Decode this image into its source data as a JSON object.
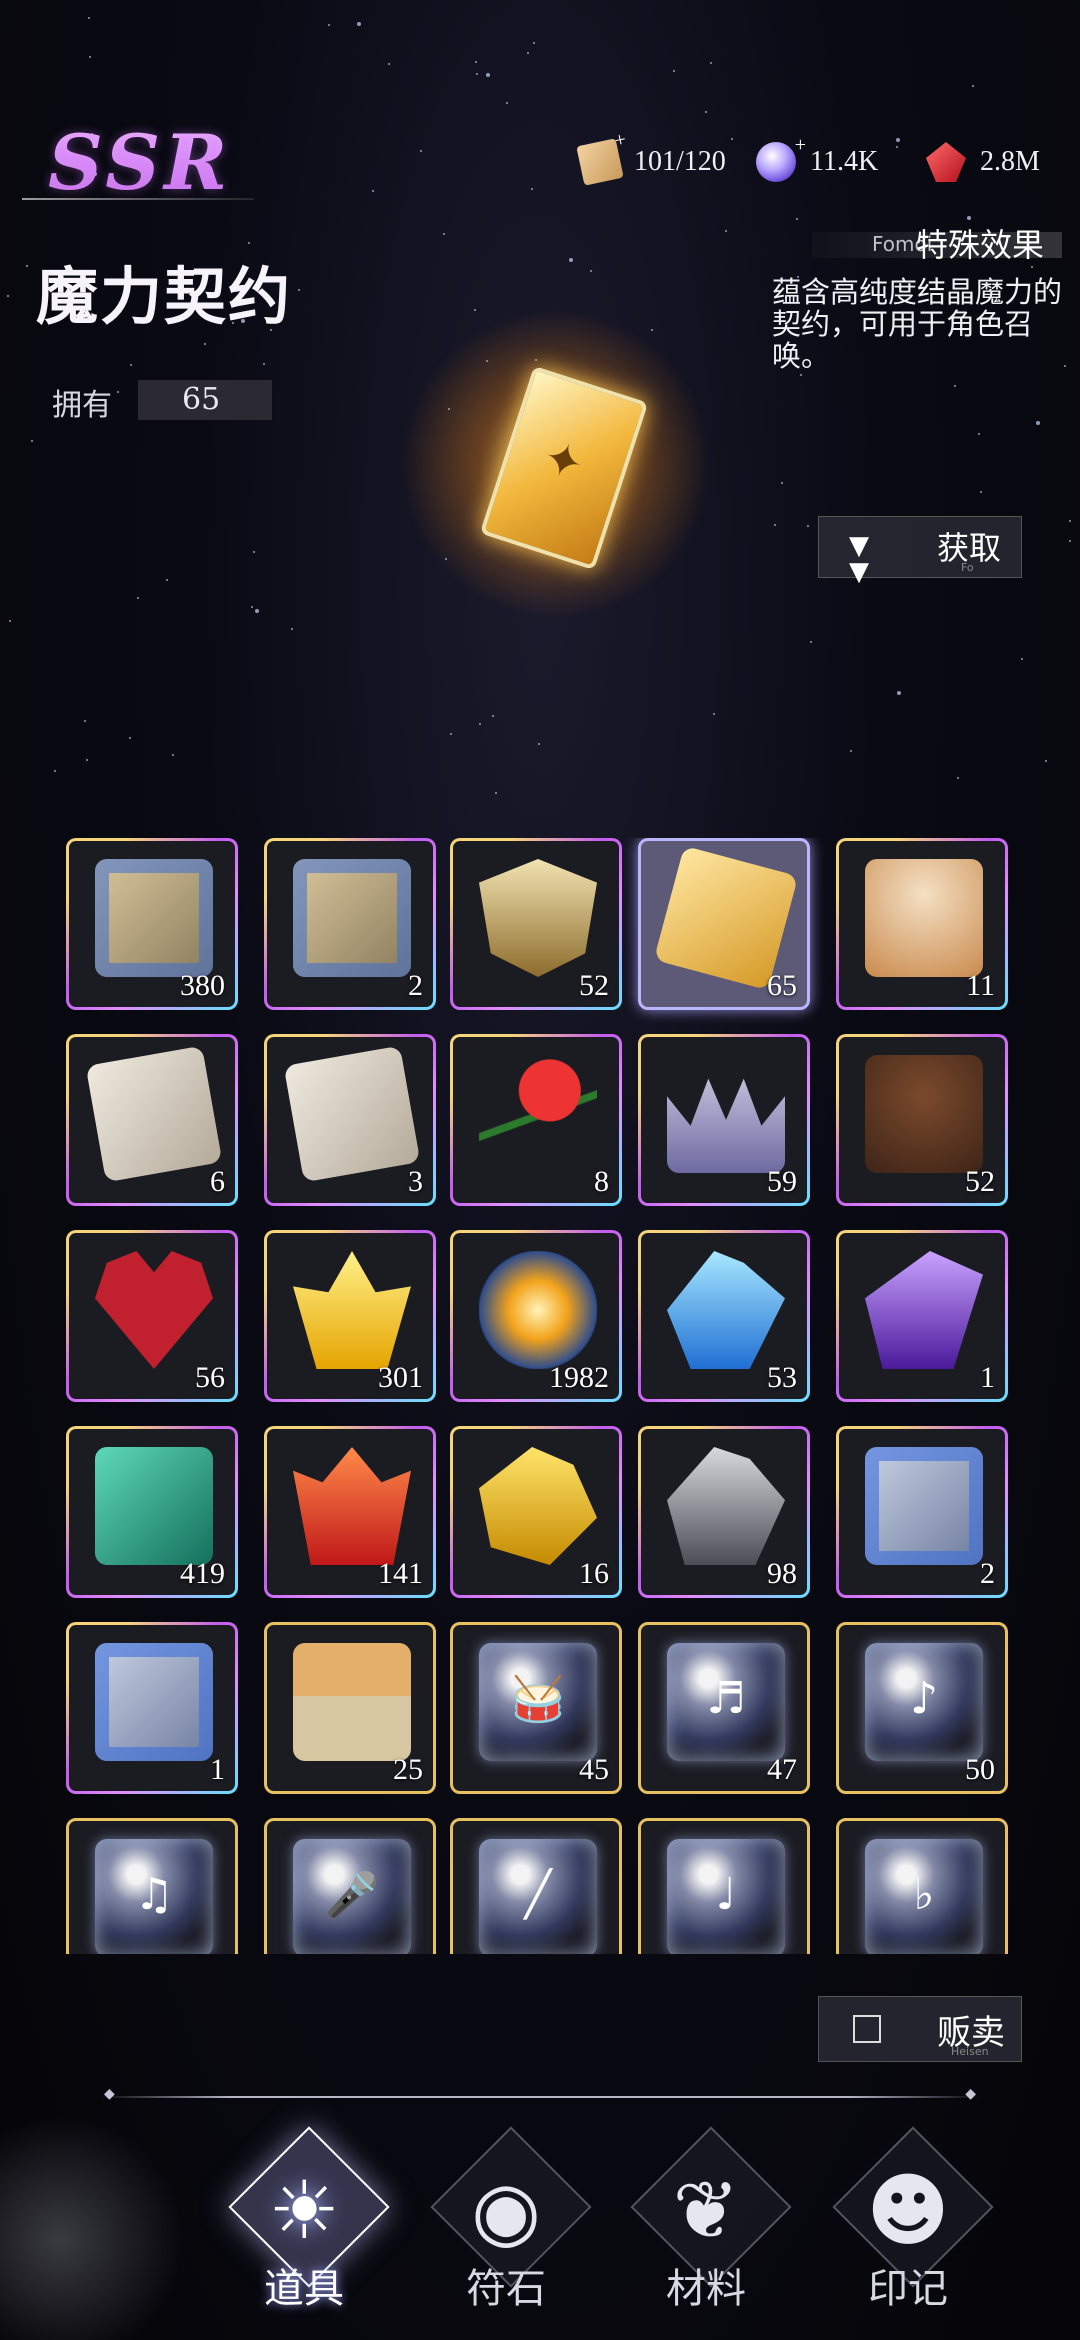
{
  "rarity": "SSR",
  "item": {
    "name": "魔力契约",
    "own_label": "拥有",
    "own_count": "65",
    "effect_en": "Fomoi",
    "effect_label": "特殊效果",
    "description": "蕴含高纯度结晶魔力的契约，可用于角色召唤。",
    "icon": "golden-contract-icon"
  },
  "resources": [
    {
      "icon": "stamina-ticket-icon",
      "value": "101/120"
    },
    {
      "icon": "crystal-orb-icon",
      "value": "11.4K"
    },
    {
      "icon": "red-gem-icon",
      "value": "2.8M"
    }
  ],
  "obtain": {
    "label": "获取",
    "sub": "Fo"
  },
  "sell": {
    "label": "贩卖",
    "sub": "Heisen"
  },
  "grid": [
    {
      "icon": "treasure-chest-icon",
      "count": "380",
      "frame": "purple"
    },
    {
      "icon": "treasure-chest-icon",
      "count": "2",
      "frame": "purple"
    },
    {
      "icon": "gold-shield-icon",
      "count": "52",
      "frame": "purple"
    },
    {
      "icon": "golden-contract-icon",
      "count": "65",
      "frame": "selected"
    },
    {
      "icon": "cake-icon",
      "count": "11",
      "frame": "purple"
    },
    {
      "icon": "sheet-music-icon",
      "count": "6",
      "frame": "purple"
    },
    {
      "icon": "sheet-music-icon",
      "count": "3",
      "frame": "purple"
    },
    {
      "icon": "red-rose-icon",
      "count": "8",
      "frame": "purple"
    },
    {
      "icon": "jewel-crown-icon",
      "count": "59",
      "frame": "purple"
    },
    {
      "icon": "chocolate-cake-icon",
      "count": "52",
      "frame": "purple"
    },
    {
      "icon": "heart-gift-box-icon",
      "count": "56",
      "frame": "purple"
    },
    {
      "icon": "yellow-crystal-icon",
      "count": "301",
      "frame": "purple"
    },
    {
      "icon": "golden-orb-icon",
      "count": "1982",
      "frame": "purple"
    },
    {
      "icon": "blue-crystal-icon",
      "count": "53",
      "frame": "purple"
    },
    {
      "icon": "purple-crystal-icon",
      "count": "1",
      "frame": "purple"
    },
    {
      "icon": "green-ore-icon",
      "count": "419",
      "frame": "purple"
    },
    {
      "icon": "red-crystal-icon",
      "count": "141",
      "frame": "purple"
    },
    {
      "icon": "gold-crystal-icon",
      "count": "16",
      "frame": "purple"
    },
    {
      "icon": "silver-ore-icon",
      "count": "98",
      "frame": "purple"
    },
    {
      "icon": "silver-chest-icon",
      "count": "2",
      "frame": "purple"
    },
    {
      "icon": "silver-chest-icon",
      "count": "1",
      "frame": "purple"
    },
    {
      "icon": "food-basket-icon",
      "count": "25",
      "frame": "gold"
    },
    {
      "icon": "drum-bubble-icon",
      "count": "45",
      "frame": "gold"
    },
    {
      "icon": "keyboard-bubble-icon",
      "count": "47",
      "frame": "gold"
    },
    {
      "icon": "guitar-bubble-icon",
      "count": "50",
      "frame": "gold"
    },
    {
      "icon": "piano-bubble-icon",
      "count": "",
      "frame": "gold"
    },
    {
      "icon": "microphone-bubble-icon",
      "count": "",
      "frame": "gold"
    },
    {
      "icon": "flute-bubble-icon",
      "count": "",
      "frame": "gold"
    },
    {
      "icon": "clarinet-bubble-icon",
      "count": "",
      "frame": "gold"
    },
    {
      "icon": "horn-bubble-icon",
      "count": "",
      "frame": "gold"
    }
  ],
  "tabs": [
    {
      "label": "道具",
      "icon": "sun-swirl-icon",
      "active": true
    },
    {
      "label": "符石",
      "icon": "flame-eye-icon",
      "active": false
    },
    {
      "label": "材料",
      "icon": "ornament-icon",
      "active": false
    },
    {
      "label": "印记",
      "icon": "hooded-face-icon",
      "active": false
    }
  ]
}
